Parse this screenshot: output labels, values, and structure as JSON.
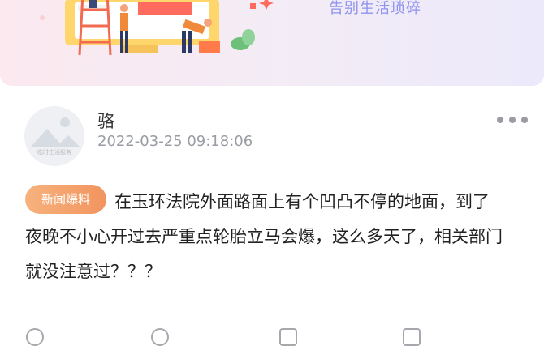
{
  "banner": {
    "slogan": "告别生活琐碎"
  },
  "post": {
    "author": "骆",
    "timestamp": "2022-03-25 09:18:06",
    "avatar_caption": "临时生活服务",
    "tag": "新闻爆料",
    "content": "在玉环法院外面路面上有个凹凸不停的地面，到了夜晚不小心开过去严重点轮胎立马会爆，这么多天了，相关部门就没注意过？？？"
  },
  "icons": {
    "more": "more-icon",
    "avatar": "avatar-placeholder-icon"
  },
  "colors": {
    "tag_start": "#f7b27d",
    "tag_end": "#f2945f",
    "slogan": "#8e93ee"
  }
}
